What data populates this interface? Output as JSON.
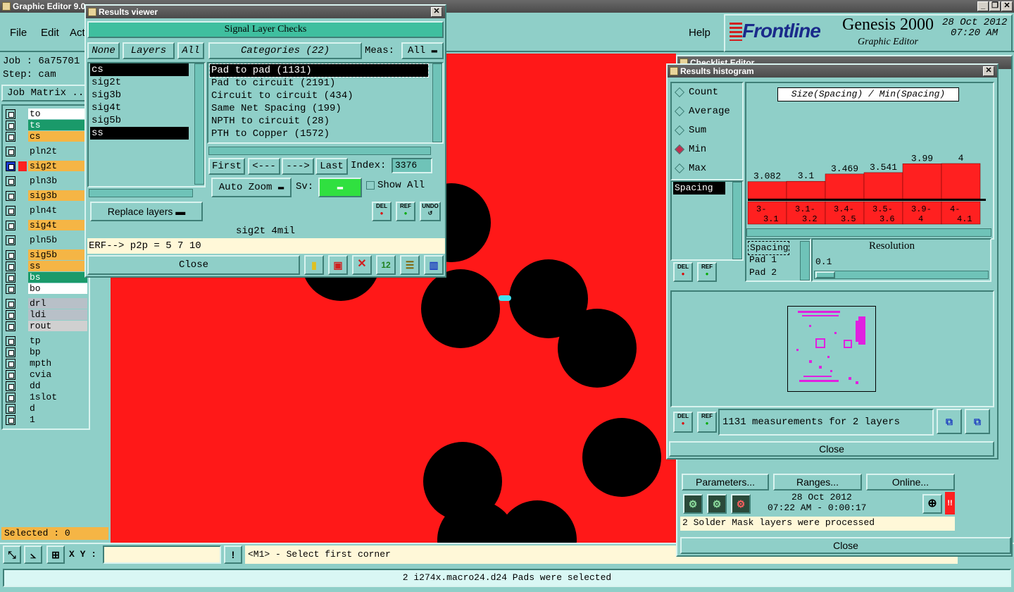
{
  "main": {
    "title": "Graphic Editor 9.0",
    "menu": [
      "File",
      "Edit",
      "Act"
    ],
    "help": "Help",
    "job": "Job : 6a75701",
    "step": "Step: cam",
    "job_matrix": "Job Matrix ...",
    "selected": "Selected : 0",
    "xy_label": "X Y :",
    "xy_value": "",
    "prompt": "<M1> - Select first corner",
    "status": "2 i274x.macro24.d24 Pads were selected"
  },
  "brand": {
    "logo": "Frontline",
    "product": "Genesis 2000",
    "subtitle": "Graphic Editor",
    "date": "28 Oct 2012",
    "time": "07:20 AM"
  },
  "layers": [
    {
      "name": "to",
      "color": "#ffffff"
    },
    {
      "name": "ts",
      "color": "#1a9a6a"
    },
    {
      "name": "cs",
      "color": "#f5b545"
    },
    {
      "name": "pln2t",
      "color": "#8fcfc8"
    },
    {
      "name": "sig2t",
      "color": "#f5b545"
    },
    {
      "name": "pln3b",
      "color": "#8fcfc8"
    },
    {
      "name": "sig3b",
      "color": "#f5b545"
    },
    {
      "name": "pln4t",
      "color": "#8fcfc8"
    },
    {
      "name": "sig4t",
      "color": "#f5b545"
    },
    {
      "name": "pln5b",
      "color": "#8fcfc8"
    },
    {
      "name": "sig5b",
      "color": "#f5b545"
    },
    {
      "name": "ss",
      "color": "#f5b545"
    },
    {
      "name": "bs",
      "color": "#1a9a6a"
    },
    {
      "name": "bo",
      "color": "#ffffff"
    },
    {
      "name": "drl",
      "color": "#b8c0c8"
    },
    {
      "name": "ldi",
      "color": "#b8c0c8"
    },
    {
      "name": "rout",
      "color": "#d0d0d0"
    },
    {
      "name": "tp",
      "color": "#8fcfc8"
    },
    {
      "name": "bp",
      "color": "#8fcfc8"
    },
    {
      "name": "mpth",
      "color": "#8fcfc8"
    },
    {
      "name": "cvia",
      "color": "#8fcfc8"
    },
    {
      "name": "dd",
      "color": "#8fcfc8"
    },
    {
      "name": "1slot",
      "color": "#8fcfc8"
    },
    {
      "name": "d",
      "color": "#8fcfc8"
    },
    {
      "name": "1",
      "color": "#8fcfc8"
    }
  ],
  "results_viewer": {
    "title": "Results viewer",
    "header": "Signal Layer Checks",
    "none": "None",
    "layers_btn": "Layers",
    "all": "All",
    "categories": "Categories (22)",
    "meas_label": "Meas:",
    "meas_value": "All",
    "layer_list": [
      "cs",
      "sig2t",
      "sig3b",
      "sig4t",
      "sig5b",
      "ss"
    ],
    "category_list": [
      "Pad to pad (1131)",
      "Pad to circuit (2191)",
      "Circuit to circuit (434)",
      "Same Net Spacing (199)",
      "NPTH to circuit (28)",
      "PTH to Copper (1572)"
    ],
    "first": "First",
    "prev": "<---",
    "next": "--->",
    "last": "Last",
    "index_label": "Index:",
    "index_value": "3376",
    "auto_zoom": "Auto Zoom",
    "sv_label": "Sv:",
    "show_all": "Show All",
    "replace_layers": "Replace layers",
    "del": "DEL",
    "ref": "REF",
    "undo": "UNDO",
    "info": "sig2t 4mil",
    "erf": "ERF--> p2p = 5 7 10",
    "close": "Close"
  },
  "checklist": {
    "title": "Checklist Editor",
    "parameters": "Parameters...",
    "ranges": "Ranges...",
    "online": "Online...",
    "date": "28 Oct 2012",
    "time": "07:22 AM - 0:00:17",
    "message": "2 Solder Mask layers were processed",
    "close": "Close"
  },
  "histogram": {
    "title": "Results histogram",
    "modes": [
      "Count",
      "Average",
      "Sum",
      "Min",
      "Max"
    ],
    "selected_mode": "Min",
    "attr_list": [
      "Spacing"
    ],
    "chart_title": "Size(Spacing) / Min(Spacing)",
    "meas_list": [
      "Spacing",
      "Pad 1",
      "Pad 2"
    ],
    "resolution_label": "Resolution",
    "resolution_value": "0.1",
    "del": "DEL",
    "ref": "REF",
    "summary": "1131 measurements for 2 layers",
    "close": "Close"
  },
  "chart_data": {
    "type": "bar",
    "title": "Size(Spacing) / Min(Spacing)",
    "categories": [
      "3-\n3.1",
      "3.1-\n3.2",
      "3.4-\n3.5",
      "3.5-\n3.6",
      "3.9-\n4",
      "4-\n4.1"
    ],
    "values": [
      3.082,
      3.1,
      3.469,
      3.541,
      3.99,
      4
    ],
    "value_labels": [
      "3.082",
      "3.1",
      "3.469",
      "3.541",
      "3.99",
      "4"
    ],
    "ylim": [
      0,
      4
    ],
    "color": "#ff2020"
  }
}
